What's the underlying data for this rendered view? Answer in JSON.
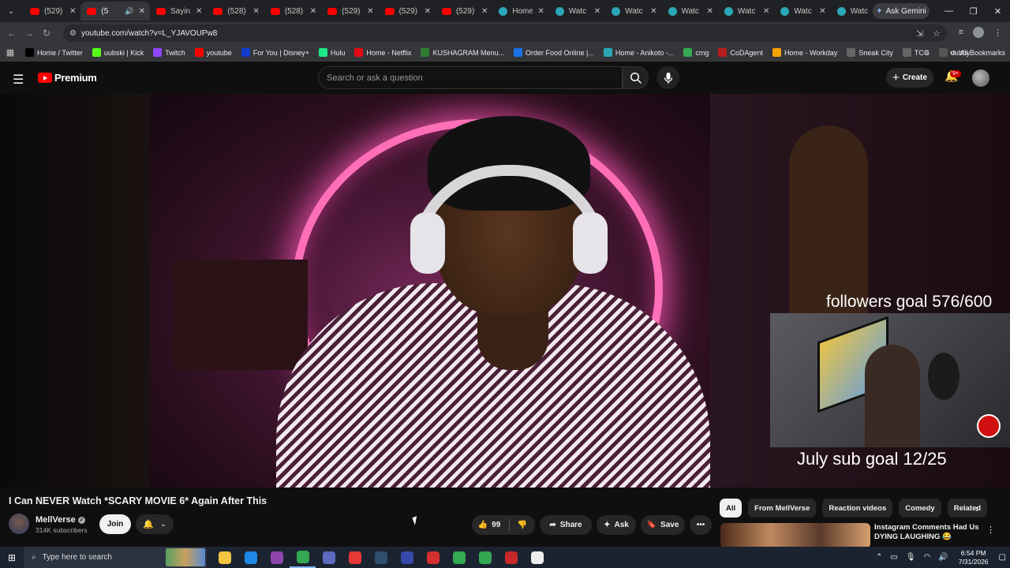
{
  "browser": {
    "tabs": [
      {
        "title": "(529)",
        "icon": "youtube-icon"
      },
      {
        "title": "(5",
        "icon": "youtube-icon",
        "active": true,
        "audio": true
      },
      {
        "title": "Sayin",
        "icon": "youtube-icon"
      },
      {
        "title": "(528)",
        "icon": "youtube-icon"
      },
      {
        "title": "(528)",
        "icon": "youtube-icon"
      },
      {
        "title": "(529)",
        "icon": "youtube-icon"
      },
      {
        "title": "(529)",
        "icon": "youtube-icon"
      },
      {
        "title": "(529)",
        "icon": "youtube-icon"
      },
      {
        "title": "Home",
        "icon": "tv-icon"
      },
      {
        "title": "Watc",
        "icon": "tv-icon"
      },
      {
        "title": "Watc",
        "icon": "tv-icon"
      },
      {
        "title": "Watc",
        "icon": "tv-icon"
      },
      {
        "title": "Watc",
        "icon": "tv-icon"
      },
      {
        "title": "Watc",
        "icon": "tv-icon"
      },
      {
        "title": "Watc",
        "icon": "tv-icon"
      }
    ],
    "gemini_label": "Ask Gemini",
    "url": "youtube.com/watch?v=L_YJAVOUPw8",
    "bookmarks": [
      {
        "label": "Home / Twitter",
        "icon": "x-icon",
        "color": "#000000"
      },
      {
        "label": "uubski | Kick",
        "icon": "kick-icon",
        "color": "#53fc18"
      },
      {
        "label": "Twitch",
        "icon": "twitch-icon",
        "color": "#9146ff"
      },
      {
        "label": "youtube",
        "icon": "youtube-icon",
        "color": "#ff0000"
      },
      {
        "label": "For You | Disney+",
        "icon": "disney-icon",
        "color": "#113ccf"
      },
      {
        "label": "Hulu",
        "icon": "hulu-icon",
        "color": "#1ce783"
      },
      {
        "label": "Home - Netflix",
        "icon": "netflix-icon",
        "color": "#e50914"
      },
      {
        "label": "KUSHAGRAM Menu...",
        "icon": "leaf-icon",
        "color": "#2e7d32"
      },
      {
        "label": "Order Food Online |...",
        "icon": "food-icon",
        "color": "#1a73e8"
      },
      {
        "label": "Home - Anikoto -...",
        "icon": "anime-icon",
        "color": "#2aa7b8"
      },
      {
        "label": "cmg",
        "icon": "cmg-icon",
        "color": "#34a853"
      },
      {
        "label": "CoDAgent",
        "icon": "cod-icon",
        "color": "#b71c1c"
      },
      {
        "label": "Home - Workday",
        "icon": "workday-icon",
        "color": "#f4a300"
      },
      {
        "label": "Sneak City",
        "icon": "globe-icon",
        "color": "#666666"
      },
      {
        "label": "TCG",
        "icon": "globe-icon",
        "color": "#666666"
      },
      {
        "label": "dubby",
        "icon": "dubby-icon",
        "color": "#555555"
      }
    ],
    "all_bookmarks": "All Bookmarks"
  },
  "youtube": {
    "logo_text": "Premium",
    "search_placeholder": "Search or ask a question",
    "create_label": "Create",
    "notif_badge": "9+",
    "overlay_top": "followers goal 576/600",
    "overlay_bottom": "July sub goal 12/25",
    "video_title": "I Can NEVER Watch *SCARY MOVIE 6* Again After This",
    "channel_name": "MellVerse",
    "subscribers": "314K subscribers",
    "join_label": "Join",
    "like_count": "99",
    "share_label": "Share",
    "ask_label": "Ask",
    "save_label": "Save",
    "chips": [
      "All",
      "From MellVerse",
      "Reaction videos",
      "Comedy",
      "Related"
    ],
    "rec_title": "Instagram Comments Had Us DYING LAUGHING 😂"
  },
  "taskbar": {
    "search_placeholder": "Type here to search",
    "time": "6:54 PM",
    "date": "7/31/2026"
  }
}
